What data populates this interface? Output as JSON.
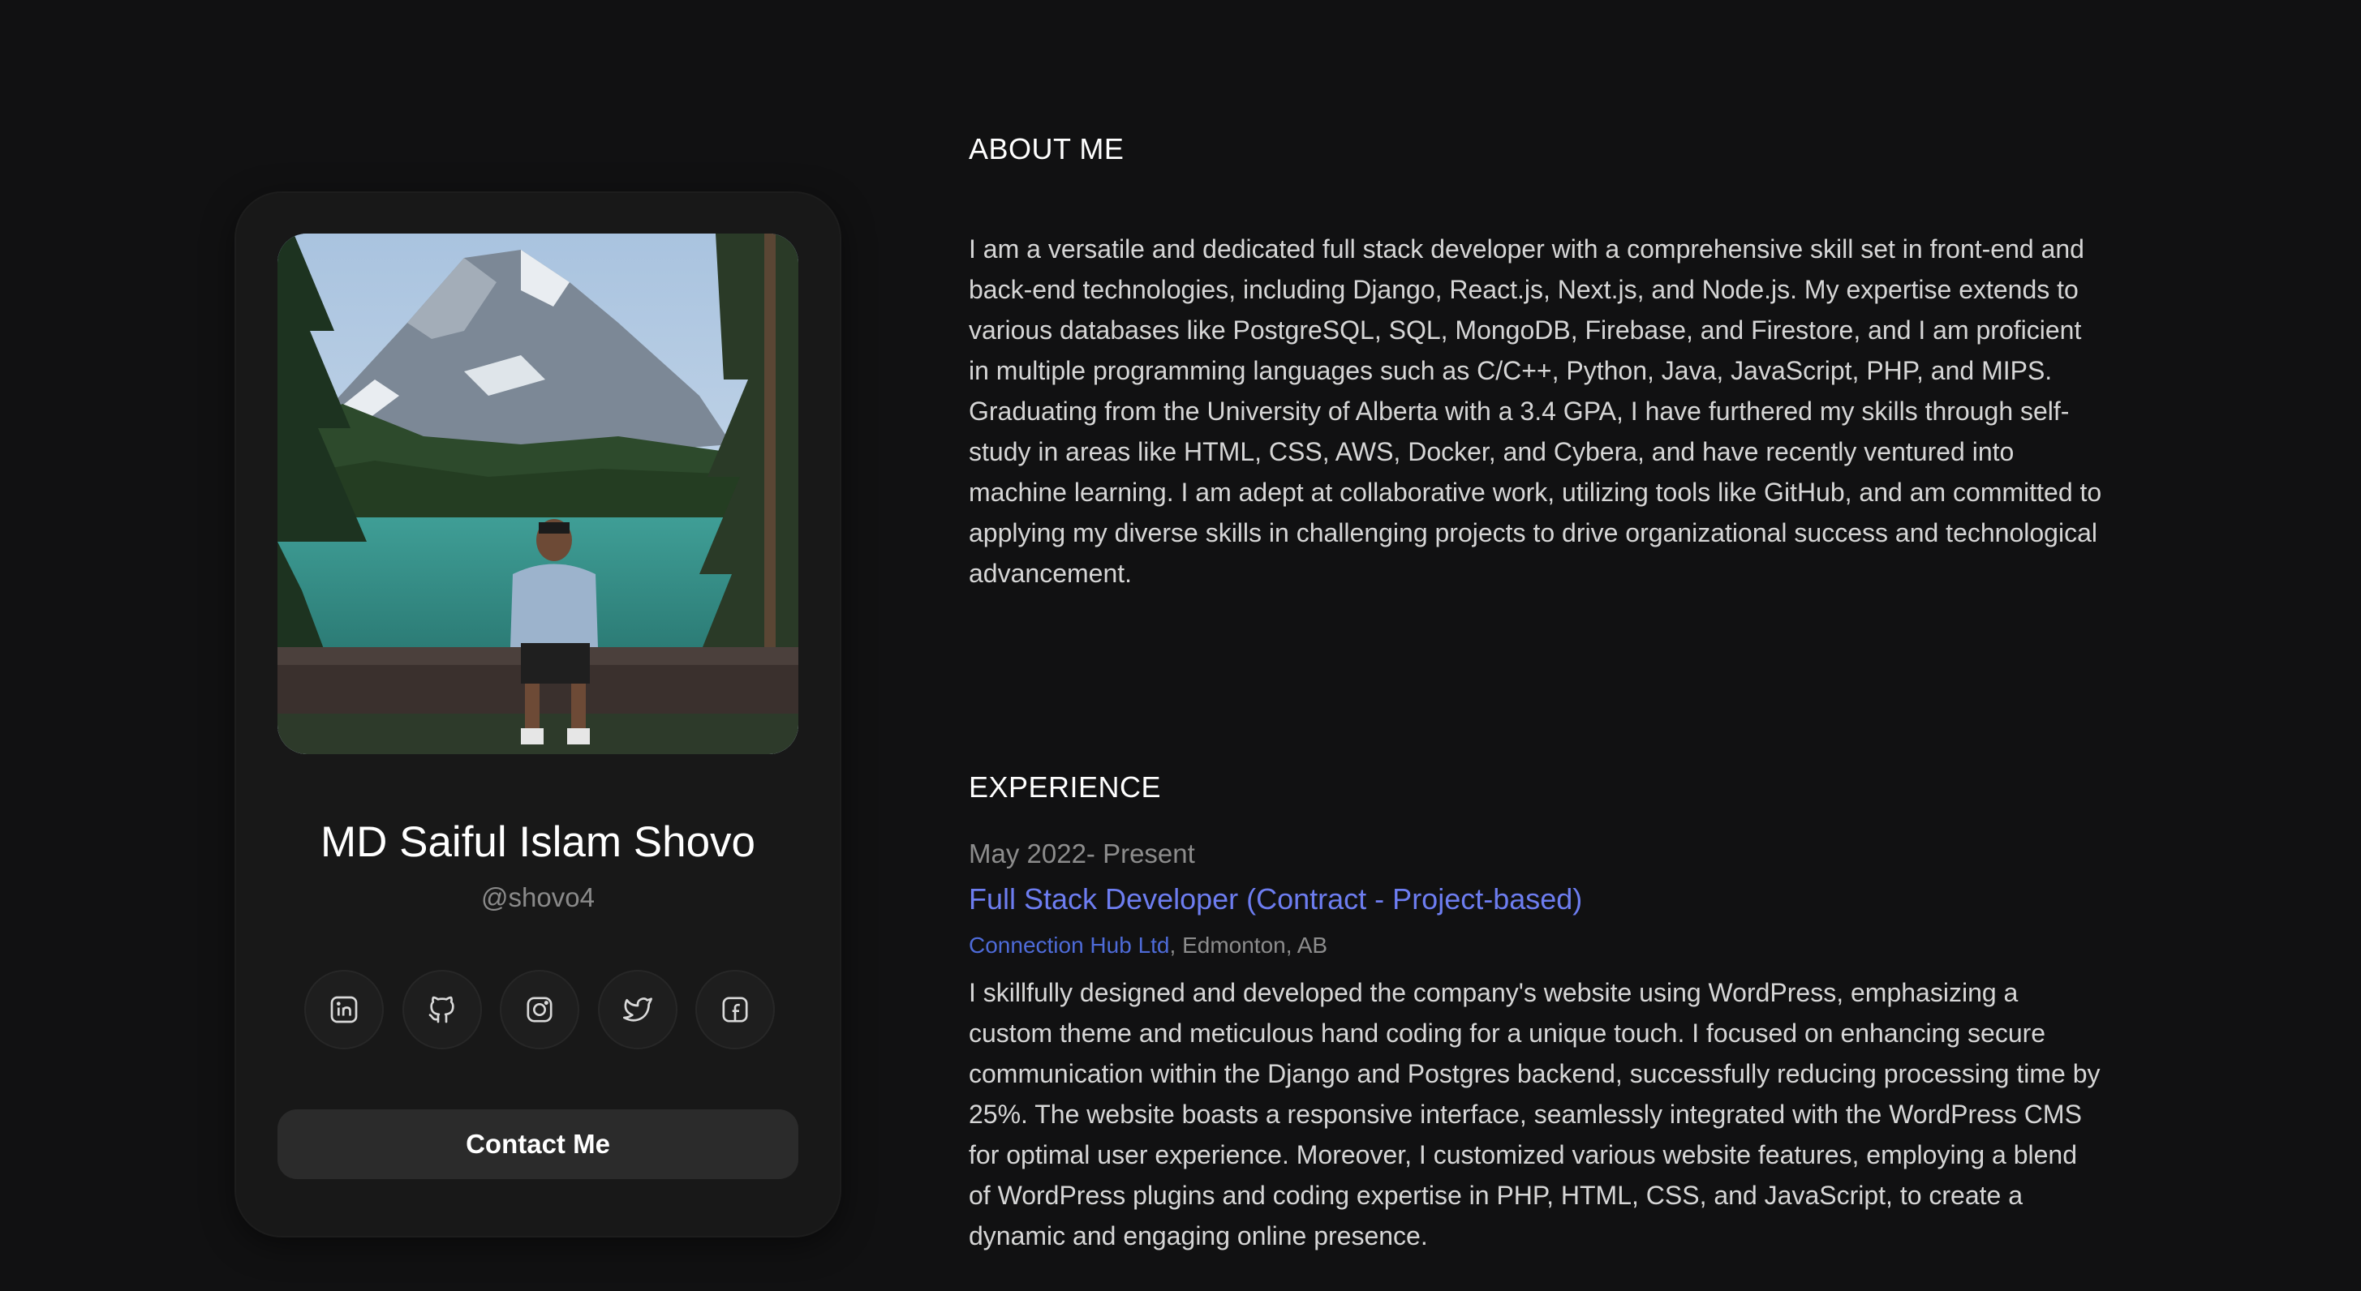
{
  "profile": {
    "name": "MD Saiful Islam Shovo",
    "handle": "@shovo4",
    "contact_label": "Contact Me",
    "socials": [
      {
        "icon": "linkedin-icon"
      },
      {
        "icon": "github-icon"
      },
      {
        "icon": "instagram-icon"
      },
      {
        "icon": "twitter-icon"
      },
      {
        "icon": "facebook-icon"
      }
    ]
  },
  "about": {
    "title": "ABOUT ME",
    "text": "I am a versatile and dedicated full stack developer with a comprehensive skill set in front-end and back-end technologies, including Django, React.js, Next.js, and Node.js. My expertise extends to various databases like PostgreSQL, SQL, MongoDB, Firebase, and Firestore, and I am proficient in multiple programming languages such as C/C++, Python, Java, JavaScript, PHP, and MIPS. Graduating from the University of Alberta with a 3.4 GPA, I have furthered my skills through self-study in areas like HTML, CSS, AWS, Docker, and Cybera, and have recently ventured into machine learning. I am adept at collaborative work, utilizing tools like GitHub, and am committed to applying my diverse skills in challenging projects to drive organizational success and technological advancement."
  },
  "experience": {
    "title": "EXPERIENCE",
    "items": [
      {
        "date": "May 2022- Present",
        "role": "Full Stack Developer (Contract - Project-based)",
        "company": "Connection Hub Ltd",
        "location": ", Edmonton, AB",
        "description": "I skillfully designed and developed the company's website using WordPress, emphasizing a custom theme and meticulous hand coding for a unique touch. I focused on enhancing secure communication within the Django and Postgres backend, successfully reducing processing time by 25%. The website boasts a responsive interface, seamlessly integrated with the WordPress CMS for optimal user experience. Moreover, I customized various website features, employing a blend of WordPress plugins and coding expertise in PHP, HTML, CSS, and JavaScript, to create a dynamic and engaging online presence."
      }
    ]
  },
  "colors": {
    "background": "#111112",
    "card": "#181818",
    "accent_role": "#6d7df0",
    "accent_company": "#4e6bd8"
  }
}
